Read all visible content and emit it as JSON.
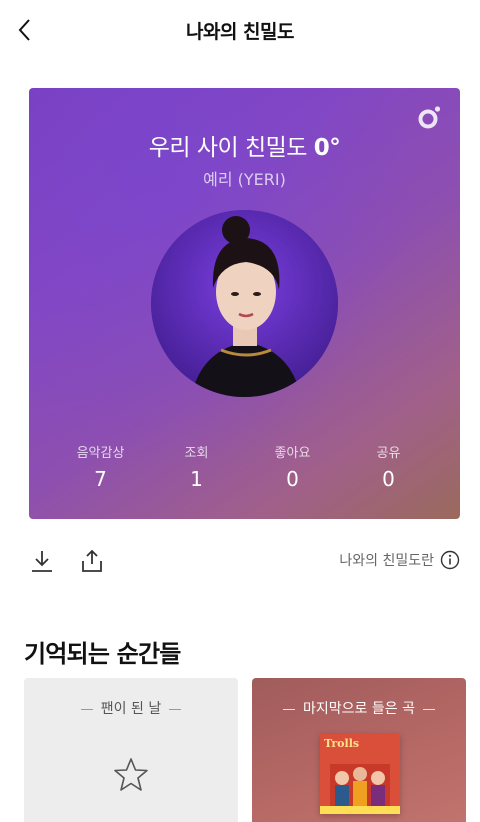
{
  "header": {
    "title": "나와의 친밀도"
  },
  "card": {
    "title_prefix": "우리 사이 친밀도 ",
    "degree": "0°",
    "artist": "예리 (YERI)",
    "stats": [
      {
        "label": "음악감상",
        "value": "7"
      },
      {
        "label": "조회",
        "value": "1"
      },
      {
        "label": "좋아요",
        "value": "0"
      },
      {
        "label": "공유",
        "value": "0"
      }
    ]
  },
  "actions": {
    "info_label": "나와의 친밀도란"
  },
  "section": {
    "title": "기억되는 순간들"
  },
  "tiles": [
    {
      "label": "팬이 된 날"
    },
    {
      "label": "마지막으로 들은 곡",
      "album_text": "Trolls"
    }
  ],
  "colors": {
    "card_start": "#7a3fc0",
    "card_end": "#9b6a5c",
    "tile_right": "#b86a66"
  }
}
